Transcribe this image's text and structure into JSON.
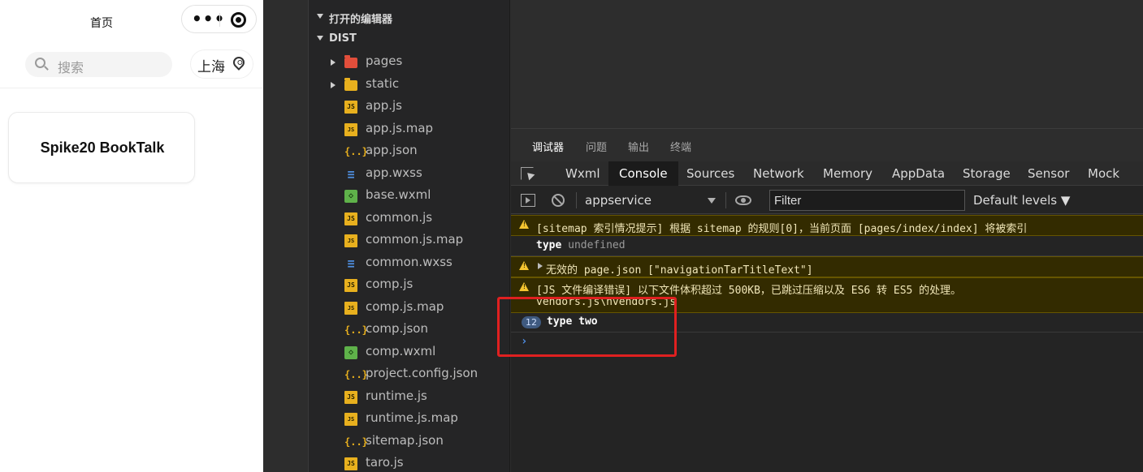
{
  "simulator": {
    "nav_title": "首页",
    "capsule_dots": "•••",
    "search_placeholder": "搜索",
    "city": "上海",
    "card_title": "Spike20 BookTalk"
  },
  "explorer": {
    "sections": [
      "打开的编辑器",
      "DIST"
    ],
    "files": [
      {
        "name": "pages",
        "icon": "folder-red-icon",
        "folder": true
      },
      {
        "name": "static",
        "icon": "folder-yellow-icon",
        "folder": true
      },
      {
        "name": "app.js",
        "icon": "js-file-icon"
      },
      {
        "name": "app.js.map",
        "icon": "js-map-file-icon"
      },
      {
        "name": "app.json",
        "icon": "json-file-icon"
      },
      {
        "name": "app.wxss",
        "icon": "css-file-icon"
      },
      {
        "name": "base.wxml",
        "icon": "wxml-file-icon"
      },
      {
        "name": "common.js",
        "icon": "js-file-icon"
      },
      {
        "name": "common.js.map",
        "icon": "js-map-file-icon"
      },
      {
        "name": "common.wxss",
        "icon": "css-file-icon"
      },
      {
        "name": "comp.js",
        "icon": "js-file-icon"
      },
      {
        "name": "comp.js.map",
        "icon": "js-map-file-icon"
      },
      {
        "name": "comp.json",
        "icon": "json-file-icon"
      },
      {
        "name": "comp.wxml",
        "icon": "wxml-file-icon"
      },
      {
        "name": "project.config.json",
        "icon": "json-file-icon"
      },
      {
        "name": "runtime.js",
        "icon": "js-file-icon"
      },
      {
        "name": "runtime.js.map",
        "icon": "js-map-file-icon"
      },
      {
        "name": "sitemap.json",
        "icon": "json-file-icon"
      },
      {
        "name": "taro.js",
        "icon": "js-file-icon"
      }
    ]
  },
  "panel": {
    "tabs": [
      "调试器",
      "问题",
      "输出",
      "终端"
    ],
    "active_tab": "调试器",
    "devtools_tabs": [
      "Wxml",
      "Console",
      "Sources",
      "Network",
      "Memory",
      "AppData",
      "Storage",
      "Sensor",
      "Mock"
    ],
    "active_devtools_tab": "Console",
    "context": "appservice",
    "filter_placeholder": "Filter",
    "levels": "Default levels ▼"
  },
  "console": {
    "warn1": "[sitemap 索引情况提示] 根据 sitemap 的规则[0]，当前页面 [pages/index/index] 将被索引",
    "log1_key": "type",
    "log1_val": "undefined",
    "warn2": "无效的 page.json [\"navigationTarTitleText\"]",
    "warn3_line1": "[JS 文件编译错误] 以下文件体积超过 500KB，已跳过压缩以及 ES6 转 ES5 的处理。",
    "warn3_line2": "vendors.js\\nvendors.js",
    "repeat_count": "12",
    "log2": "type two",
    "prompt": "›"
  },
  "colors": {
    "warn_bg": "#332b00",
    "warn_icon": "#f4c430",
    "highlight_box": "#e02020",
    "folder_red": "#e24e3b",
    "js_yellow": "#e8b01e",
    "css_blue": "#4f8fe0",
    "wxml_green": "#5fb24a"
  }
}
